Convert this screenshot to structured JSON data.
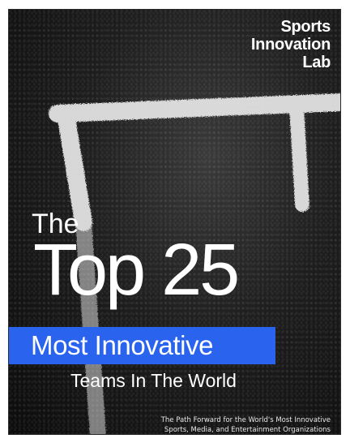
{
  "brand": {
    "line1": "Sports",
    "line2": "Innovation",
    "line3": "Lab"
  },
  "title": {
    "the": "The",
    "top25": "Top 25",
    "highlight": "Most Innovative",
    "subtitle": "Teams In The World"
  },
  "tagline": {
    "line1": "The Path Forward for the World's Most Innovative",
    "line2": "Sports, Media, and Entertainment Organizations"
  },
  "colors": {
    "background": "#141414",
    "accent": "#2a63ee",
    "text": "#ffffff"
  }
}
